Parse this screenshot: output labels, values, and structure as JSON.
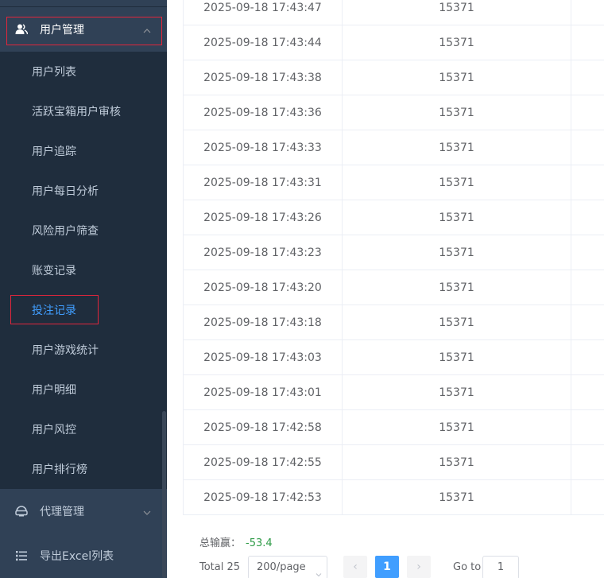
{
  "sidebar": {
    "user_mgmt": {
      "label": "用户管理",
      "icon": "user-group-icon"
    },
    "items": [
      {
        "label": "用户列表"
      },
      {
        "label": "活跃宝箱用户审核"
      },
      {
        "label": "用户追踪"
      },
      {
        "label": "用户每日分析"
      },
      {
        "label": "风险用户筛查"
      },
      {
        "label": "账变记录"
      },
      {
        "label": "投注记录",
        "active": true
      },
      {
        "label": "用户游戏统计"
      },
      {
        "label": "用户明细"
      },
      {
        "label": "用户风控"
      },
      {
        "label": "用户排行榜"
      }
    ],
    "agent_mgmt": {
      "label": "代理管理",
      "icon": "agent-icon"
    },
    "export_list": {
      "label": "导出Excel列表",
      "icon": "list-icon"
    }
  },
  "table": {
    "rows": [
      {
        "time": "2025-09-18 17:43:47",
        "id": "15371"
      },
      {
        "time": "2025-09-18 17:43:44",
        "id": "15371"
      },
      {
        "time": "2025-09-18 17:43:38",
        "id": "15371"
      },
      {
        "time": "2025-09-18 17:43:36",
        "id": "15371"
      },
      {
        "time": "2025-09-18 17:43:33",
        "id": "15371"
      },
      {
        "time": "2025-09-18 17:43:31",
        "id": "15371"
      },
      {
        "time": "2025-09-18 17:43:26",
        "id": "15371"
      },
      {
        "time": "2025-09-18 17:43:23",
        "id": "15371"
      },
      {
        "time": "2025-09-18 17:43:20",
        "id": "15371"
      },
      {
        "time": "2025-09-18 17:43:18",
        "id": "15371"
      },
      {
        "time": "2025-09-18 17:43:03",
        "id": "15371"
      },
      {
        "time": "2025-09-18 17:43:01",
        "id": "15371"
      },
      {
        "time": "2025-09-18 17:42:58",
        "id": "15371"
      },
      {
        "time": "2025-09-18 17:42:55",
        "id": "15371"
      },
      {
        "time": "2025-09-18 17:42:53",
        "id": "15371"
      }
    ]
  },
  "summary": {
    "label": "总输赢：",
    "value": "-53.4",
    "value_color": "#2e9b47"
  },
  "pagination": {
    "total": "Total 25",
    "page_size": "200/page",
    "prev": "‹",
    "current_page": "1",
    "next": "›",
    "goto_label": "Go to",
    "goto_value": "1"
  },
  "colors": {
    "sidebar_bg": "#1f2d3d",
    "submenu_title_bg": "#304156",
    "active": "#409eff",
    "highlight_box": "#e0263c"
  }
}
